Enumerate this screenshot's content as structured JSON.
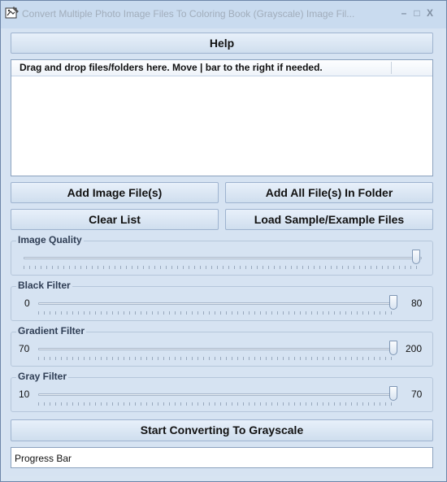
{
  "window": {
    "title": "Convert Multiple Photo Image Files To Coloring Book (Grayscale) Image Fil..."
  },
  "titlebar": {
    "minimize_glyph": "–",
    "maximize_glyph": "□",
    "close_glyph": "X"
  },
  "buttons": {
    "help": "Help",
    "add_image_files": "Add Image File(s)",
    "add_all_files": "Add All File(s) In Folder",
    "clear_list": "Clear List",
    "load_sample": "Load Sample/Example Files",
    "start": "Start Converting To Grayscale"
  },
  "file_list": {
    "header": "Drag and drop files/folders here. Move | bar to the right if needed."
  },
  "sliders": [
    {
      "label": "Image Quality",
      "min_label": "",
      "max_label": "",
      "level": 1.0
    },
    {
      "label": "Black Filter",
      "min_label": "0",
      "max_label": "80",
      "level": 1.0
    },
    {
      "label": "Gradient Filter",
      "min_label": "70",
      "max_label": "200",
      "level": 1.0
    },
    {
      "label": "Gray Filter",
      "min_label": "10",
      "max_label": "70",
      "level": 1.0
    }
  ],
  "progress": {
    "label": "Progress Bar"
  },
  "colors": {
    "accent": "#d6e3f2",
    "button_border": "#9eb3cf"
  }
}
